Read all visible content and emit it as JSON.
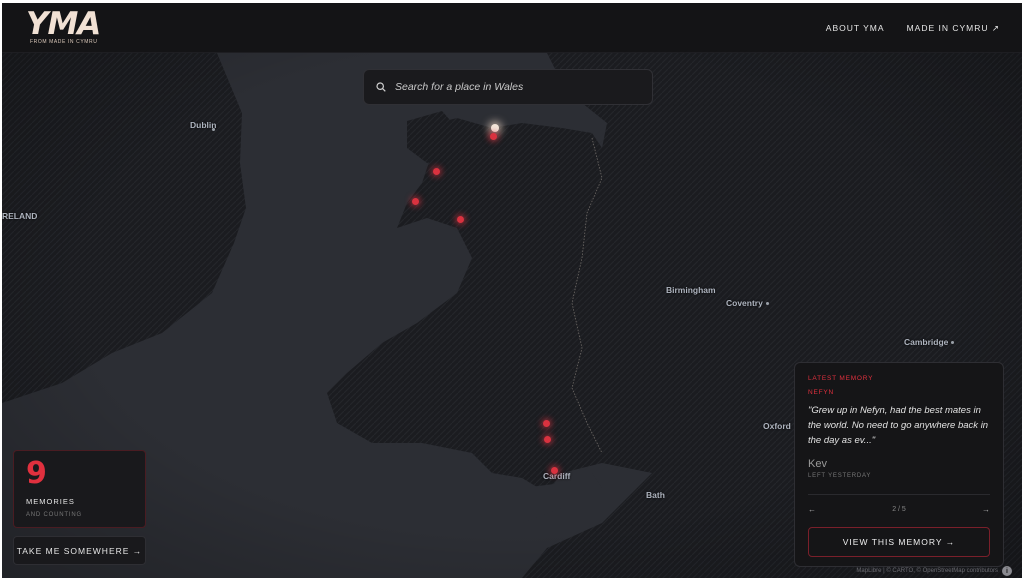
{
  "header": {
    "logo_text": "YMA",
    "logo_subtext": "FROM MADE IN CYMRU",
    "nav": [
      {
        "label": "ABOUT YMA"
      },
      {
        "label": "MADE IN CYMRU ↗"
      }
    ]
  },
  "search": {
    "placeholder": "Search for a place in Wales",
    "icon": "search-icon"
  },
  "map": {
    "labels": {
      "dublin": "Dublin",
      "ireland": "RELAND",
      "birmingham": "Birmingham",
      "coventry": "Coventry",
      "cambridge": "Cambridge",
      "oxford": "Oxford",
      "cardiff": "Cardiff",
      "bath": "Bath"
    },
    "colors": {
      "background": "#2a2c31",
      "land": "#1b1c20",
      "sea": "#2c2e34",
      "marker": "#d9323f",
      "marker_active": "#f3e6da"
    },
    "attribution": "MapLibre | © CARTO, © OpenStreetMap contributors",
    "info_icon": "i"
  },
  "counter": {
    "value": "9",
    "label": "MEMORIES",
    "sublabel": "AND COUNTING"
  },
  "take_button": {
    "label": "TAKE ME SOMEWHERE →"
  },
  "memory_card": {
    "kicker": "LATEST MEMORY",
    "place": "NEFYN",
    "quote": "\"Grew up in Nefyn, had the best mates in the world. No need to go anywhere back in the day as ev...\"",
    "author": "Kev",
    "when": "LEFT YESTERDAY",
    "prev": "←",
    "next": "→",
    "page": "2 / 5",
    "view_button": "VIEW THIS MEMORY →",
    "accent": "#e0303e"
  }
}
